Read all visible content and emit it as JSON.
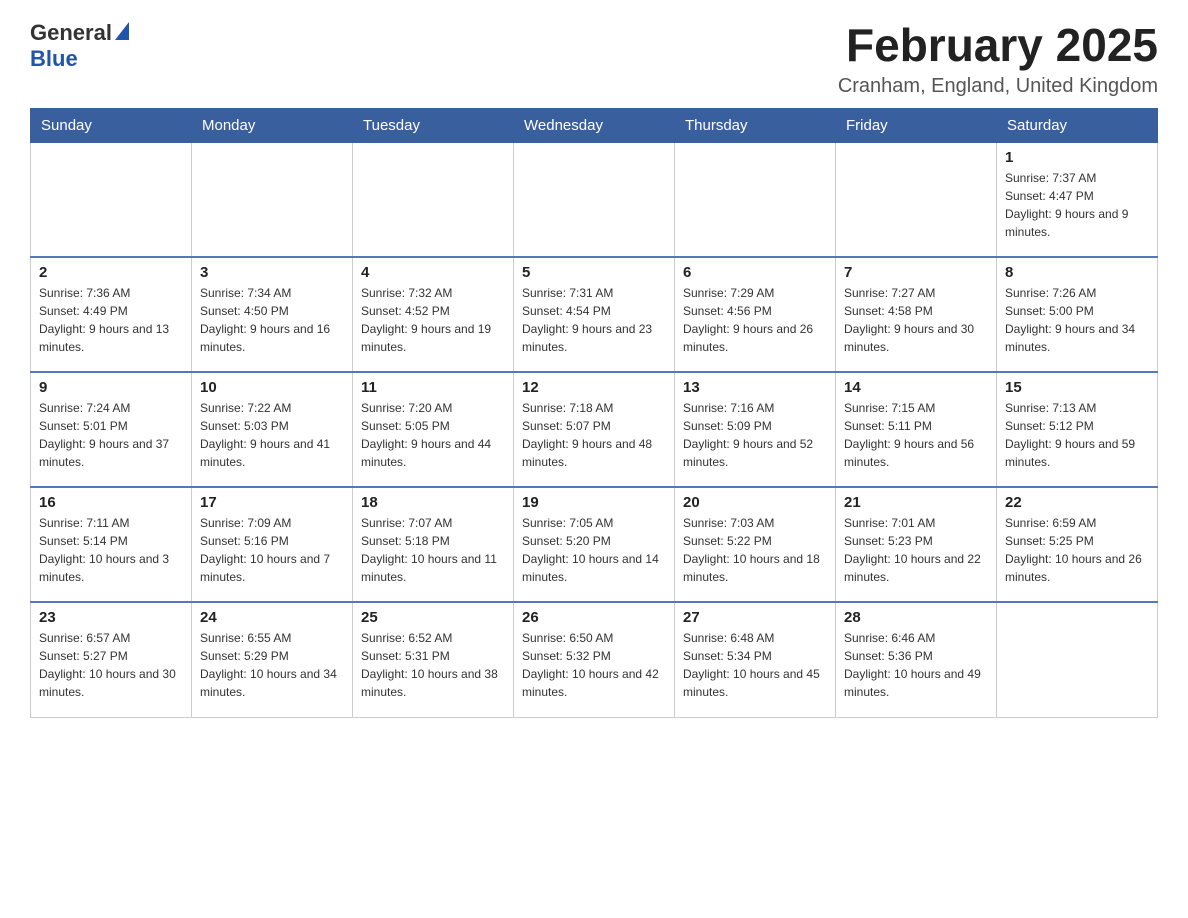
{
  "header": {
    "logo": {
      "general": "General",
      "blue": "Blue"
    },
    "title": "February 2025",
    "location": "Cranham, England, United Kingdom"
  },
  "weekdays": [
    "Sunday",
    "Monday",
    "Tuesday",
    "Wednesday",
    "Thursday",
    "Friday",
    "Saturday"
  ],
  "weeks": [
    [
      {
        "day": "",
        "sunrise": "",
        "sunset": "",
        "daylight": ""
      },
      {
        "day": "",
        "sunrise": "",
        "sunset": "",
        "daylight": ""
      },
      {
        "day": "",
        "sunrise": "",
        "sunset": "",
        "daylight": ""
      },
      {
        "day": "",
        "sunrise": "",
        "sunset": "",
        "daylight": ""
      },
      {
        "day": "",
        "sunrise": "",
        "sunset": "",
        "daylight": ""
      },
      {
        "day": "",
        "sunrise": "",
        "sunset": "",
        "daylight": ""
      },
      {
        "day": "1",
        "sunrise": "Sunrise: 7:37 AM",
        "sunset": "Sunset: 4:47 PM",
        "daylight": "Daylight: 9 hours and 9 minutes."
      }
    ],
    [
      {
        "day": "2",
        "sunrise": "Sunrise: 7:36 AM",
        "sunset": "Sunset: 4:49 PM",
        "daylight": "Daylight: 9 hours and 13 minutes."
      },
      {
        "day": "3",
        "sunrise": "Sunrise: 7:34 AM",
        "sunset": "Sunset: 4:50 PM",
        "daylight": "Daylight: 9 hours and 16 minutes."
      },
      {
        "day": "4",
        "sunrise": "Sunrise: 7:32 AM",
        "sunset": "Sunset: 4:52 PM",
        "daylight": "Daylight: 9 hours and 19 minutes."
      },
      {
        "day": "5",
        "sunrise": "Sunrise: 7:31 AM",
        "sunset": "Sunset: 4:54 PM",
        "daylight": "Daylight: 9 hours and 23 minutes."
      },
      {
        "day": "6",
        "sunrise": "Sunrise: 7:29 AM",
        "sunset": "Sunset: 4:56 PM",
        "daylight": "Daylight: 9 hours and 26 minutes."
      },
      {
        "day": "7",
        "sunrise": "Sunrise: 7:27 AM",
        "sunset": "Sunset: 4:58 PM",
        "daylight": "Daylight: 9 hours and 30 minutes."
      },
      {
        "day": "8",
        "sunrise": "Sunrise: 7:26 AM",
        "sunset": "Sunset: 5:00 PM",
        "daylight": "Daylight: 9 hours and 34 minutes."
      }
    ],
    [
      {
        "day": "9",
        "sunrise": "Sunrise: 7:24 AM",
        "sunset": "Sunset: 5:01 PM",
        "daylight": "Daylight: 9 hours and 37 minutes."
      },
      {
        "day": "10",
        "sunrise": "Sunrise: 7:22 AM",
        "sunset": "Sunset: 5:03 PM",
        "daylight": "Daylight: 9 hours and 41 minutes."
      },
      {
        "day": "11",
        "sunrise": "Sunrise: 7:20 AM",
        "sunset": "Sunset: 5:05 PM",
        "daylight": "Daylight: 9 hours and 44 minutes."
      },
      {
        "day": "12",
        "sunrise": "Sunrise: 7:18 AM",
        "sunset": "Sunset: 5:07 PM",
        "daylight": "Daylight: 9 hours and 48 minutes."
      },
      {
        "day": "13",
        "sunrise": "Sunrise: 7:16 AM",
        "sunset": "Sunset: 5:09 PM",
        "daylight": "Daylight: 9 hours and 52 minutes."
      },
      {
        "day": "14",
        "sunrise": "Sunrise: 7:15 AM",
        "sunset": "Sunset: 5:11 PM",
        "daylight": "Daylight: 9 hours and 56 minutes."
      },
      {
        "day": "15",
        "sunrise": "Sunrise: 7:13 AM",
        "sunset": "Sunset: 5:12 PM",
        "daylight": "Daylight: 9 hours and 59 minutes."
      }
    ],
    [
      {
        "day": "16",
        "sunrise": "Sunrise: 7:11 AM",
        "sunset": "Sunset: 5:14 PM",
        "daylight": "Daylight: 10 hours and 3 minutes."
      },
      {
        "day": "17",
        "sunrise": "Sunrise: 7:09 AM",
        "sunset": "Sunset: 5:16 PM",
        "daylight": "Daylight: 10 hours and 7 minutes."
      },
      {
        "day": "18",
        "sunrise": "Sunrise: 7:07 AM",
        "sunset": "Sunset: 5:18 PM",
        "daylight": "Daylight: 10 hours and 11 minutes."
      },
      {
        "day": "19",
        "sunrise": "Sunrise: 7:05 AM",
        "sunset": "Sunset: 5:20 PM",
        "daylight": "Daylight: 10 hours and 14 minutes."
      },
      {
        "day": "20",
        "sunrise": "Sunrise: 7:03 AM",
        "sunset": "Sunset: 5:22 PM",
        "daylight": "Daylight: 10 hours and 18 minutes."
      },
      {
        "day": "21",
        "sunrise": "Sunrise: 7:01 AM",
        "sunset": "Sunset: 5:23 PM",
        "daylight": "Daylight: 10 hours and 22 minutes."
      },
      {
        "day": "22",
        "sunrise": "Sunrise: 6:59 AM",
        "sunset": "Sunset: 5:25 PM",
        "daylight": "Daylight: 10 hours and 26 minutes."
      }
    ],
    [
      {
        "day": "23",
        "sunrise": "Sunrise: 6:57 AM",
        "sunset": "Sunset: 5:27 PM",
        "daylight": "Daylight: 10 hours and 30 minutes."
      },
      {
        "day": "24",
        "sunrise": "Sunrise: 6:55 AM",
        "sunset": "Sunset: 5:29 PM",
        "daylight": "Daylight: 10 hours and 34 minutes."
      },
      {
        "day": "25",
        "sunrise": "Sunrise: 6:52 AM",
        "sunset": "Sunset: 5:31 PM",
        "daylight": "Daylight: 10 hours and 38 minutes."
      },
      {
        "day": "26",
        "sunrise": "Sunrise: 6:50 AM",
        "sunset": "Sunset: 5:32 PM",
        "daylight": "Daylight: 10 hours and 42 minutes."
      },
      {
        "day": "27",
        "sunrise": "Sunrise: 6:48 AM",
        "sunset": "Sunset: 5:34 PM",
        "daylight": "Daylight: 10 hours and 45 minutes."
      },
      {
        "day": "28",
        "sunrise": "Sunrise: 6:46 AM",
        "sunset": "Sunset: 5:36 PM",
        "daylight": "Daylight: 10 hours and 49 minutes."
      },
      {
        "day": "",
        "sunrise": "",
        "sunset": "",
        "daylight": ""
      }
    ]
  ]
}
